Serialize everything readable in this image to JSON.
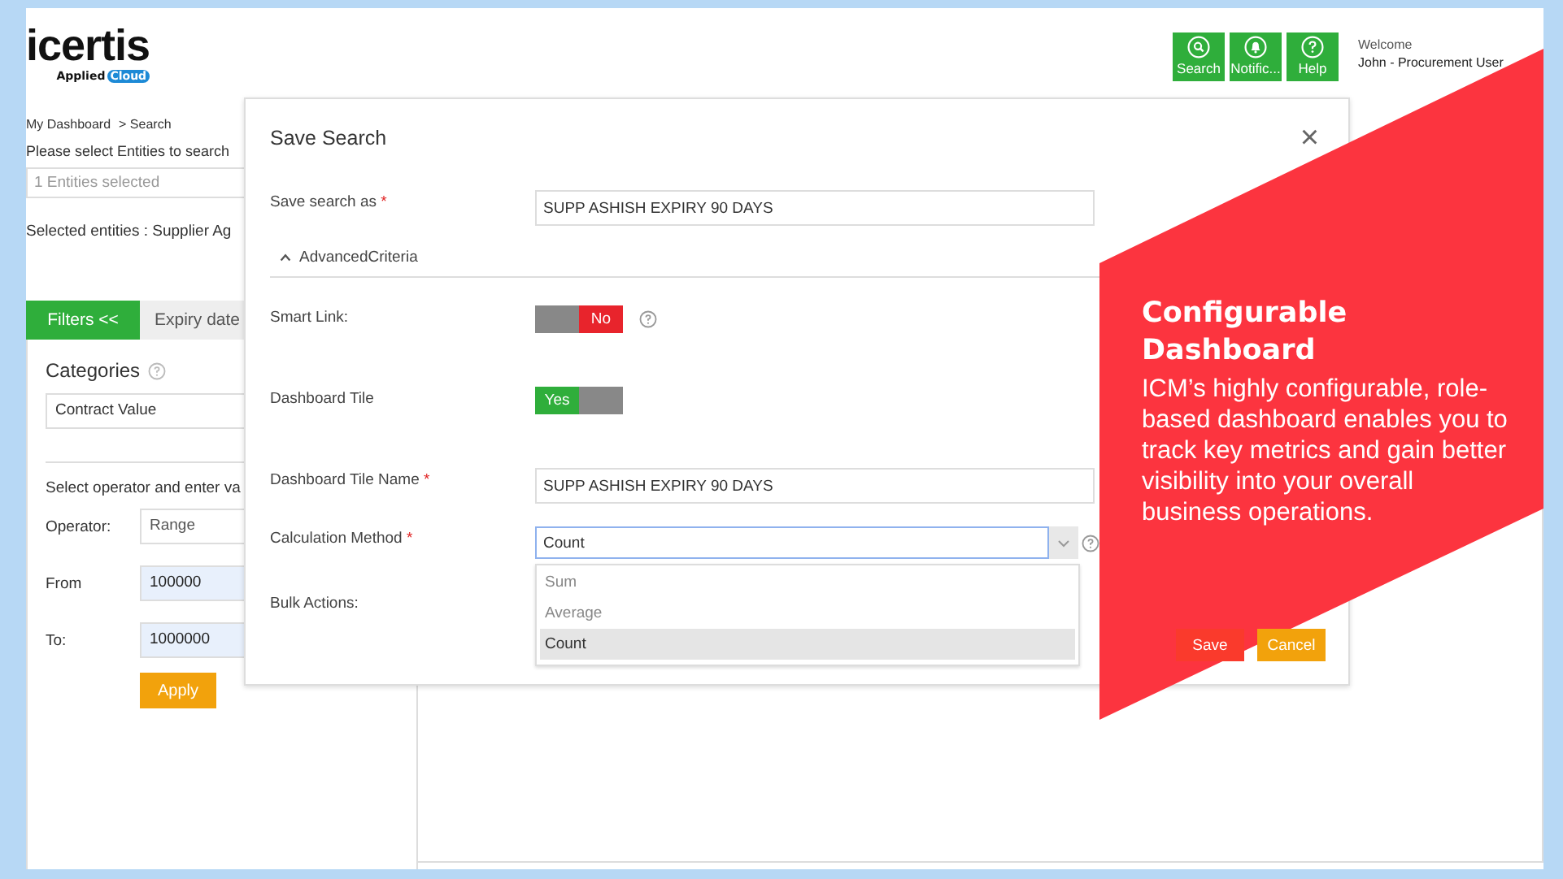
{
  "header": {
    "logo": "icertis",
    "logo_sub": "Applied",
    "logo_badge": "Cloud",
    "buttons": [
      {
        "label": "Search"
      },
      {
        "label": "Notific..."
      },
      {
        "label": "Help"
      }
    ],
    "welcome": "Welcome",
    "user": "John - Procurement User"
  },
  "breadcrumb": [
    "My Dashboard",
    "> Search"
  ],
  "entity_prompt": "Please select Entities to search",
  "entity_select": {
    "placeholder": "1 Entities selected"
  },
  "selected_entities": "Selected entities : Supplier Ag",
  "filter_tabs": [
    {
      "label": "Filters <<",
      "selected": true
    },
    {
      "label": "Expiry date",
      "selected": false
    }
  ],
  "filters": {
    "title": "Categories",
    "category": "Contract Value",
    "instruction": "Select operator and enter va",
    "fields": [
      {
        "label": "Operator:",
        "value": "Range",
        "kind": "select"
      },
      {
        "label": "From",
        "value": "100000",
        "kind": "number"
      },
      {
        "label": "To:",
        "value": "1000000",
        "kind": "number"
      }
    ],
    "apply": "Apply"
  },
  "dialog": {
    "title": "Save Search",
    "close": "×",
    "rows": [
      {
        "kind": "text",
        "label": "Save search as",
        "required_mark": "*",
        "value": "SUPP ASHISH EXPIRY 90 DAYS"
      },
      {
        "kind": "section",
        "label": "AdvancedCriteria",
        "expanded": true
      },
      {
        "kind": "toggle",
        "label": "Smart Link:",
        "on": false,
        "text": "No",
        "help": true
      },
      {
        "kind": "toggle",
        "label": "Dashboard Tile",
        "on": true,
        "text": "Yes",
        "help": false
      },
      {
        "kind": "text",
        "label": "Dashboard Tile Name",
        "required_mark": "*",
        "value": "SUPP ASHISH EXPIRY 90 DAYS"
      },
      {
        "kind": "combo",
        "label": "Calculation Method",
        "required_mark": "*",
        "value": "Count",
        "help": true,
        "options": [
          {
            "label": "Sum",
            "selected": false
          },
          {
            "label": "Average",
            "selected": false
          },
          {
            "label": "Count",
            "selected": true
          }
        ]
      },
      {
        "kind": "label",
        "label": "Bulk Actions:"
      }
    ],
    "buttons": [
      {
        "label": "Save",
        "kind": "primary"
      },
      {
        "label": "Cancel",
        "kind": "secondary"
      }
    ]
  },
  "banner": {
    "title": "Configurable Dashboard",
    "body": "ICM’s highly configurable, role-based dashboard enables you to track key metrics and gain better visibility into your overall business operations."
  }
}
